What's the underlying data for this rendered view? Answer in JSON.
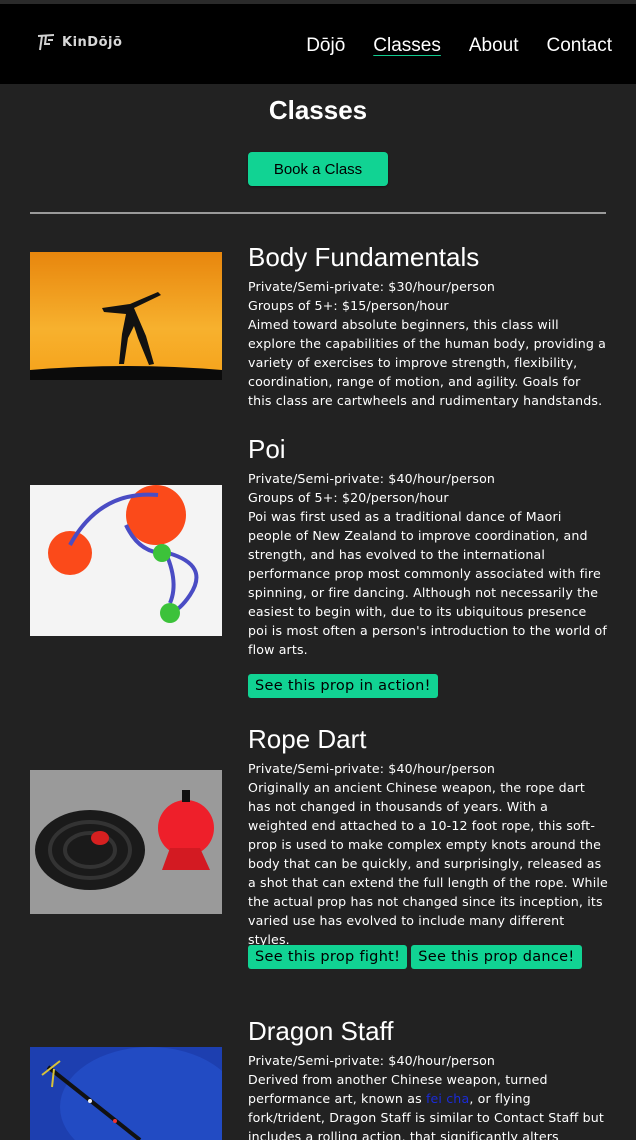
{
  "nav": {
    "logo_text": "KinDōjō",
    "items": [
      {
        "label": "Dōjō",
        "active": false
      },
      {
        "label": "Classes",
        "active": true
      },
      {
        "label": "About",
        "active": false
      },
      {
        "label": "Contact",
        "active": false
      }
    ]
  },
  "page": {
    "title": "Classes",
    "book_button": "Book a Class"
  },
  "classes": [
    {
      "title": "Body Fundamentals",
      "price_private": "Private/Semi-private: $30/hour/person",
      "price_group": "Groups of 5+: $15/person/hour",
      "description": "Aimed toward absolute beginners, this class will explore the capabilities of the human body, providing a variety of exercises to improve strength, flexibility, coordination, range of motion, and agility. Goals for this class are cartwheels and rudimentary handstands.",
      "image_icon": "cartwheel-silhouette-photo"
    },
    {
      "title": "Poi",
      "price_private": "Private/Semi-private: $40/hour/person",
      "price_group": "Groups of 5+: $20/person/hour",
      "description": "Poi was first used as a traditional dance of Maori people of New Zealand to improve coordination, and strength, and has evolved to the international performance prop most commonly associated with fire spinning, or fire dancing. Although not necessarily the easiest to begin with, due to its ubiquitous presence poi is most often a person's introduction to the world of flow arts.",
      "buttons": [
        "See this prop in action!"
      ],
      "image_icon": "poi-balls-photo"
    },
    {
      "title": "Rope Dart",
      "price_private": "Private/Semi-private: $40/hour/person",
      "description": "Originally an ancient Chinese weapon, the rope dart has not changed in thousands of years. With a weighted end attached to a 10-12 foot rope, this soft-prop is used to make complex empty knots around the body that can be quickly, and surprisingly, released as a shot that can extend the full length of the rope. While the actual prop has not changed since its inception, its varied use has evolved to include many different styles.",
      "buttons": [
        "See this prop fight!",
        "See this prop dance!"
      ],
      "image_icon": "rope-dart-photo"
    },
    {
      "title": "Dragon Staff",
      "price_private": "Private/Semi-private: $40/hour/person",
      "description_before": "Derived from another Chinese weapon, turned performance art, known as ",
      "description_link": "fei cha",
      "description_after": ", or flying fork/trident, Dragon Staff is similar to Contact Staff but includes a rolling action, that significantly alters",
      "image_icon": "dragon-staff-photo"
    }
  ],
  "colors": {
    "accent": "#11d393",
    "background": "#222222",
    "header": "#000000"
  }
}
